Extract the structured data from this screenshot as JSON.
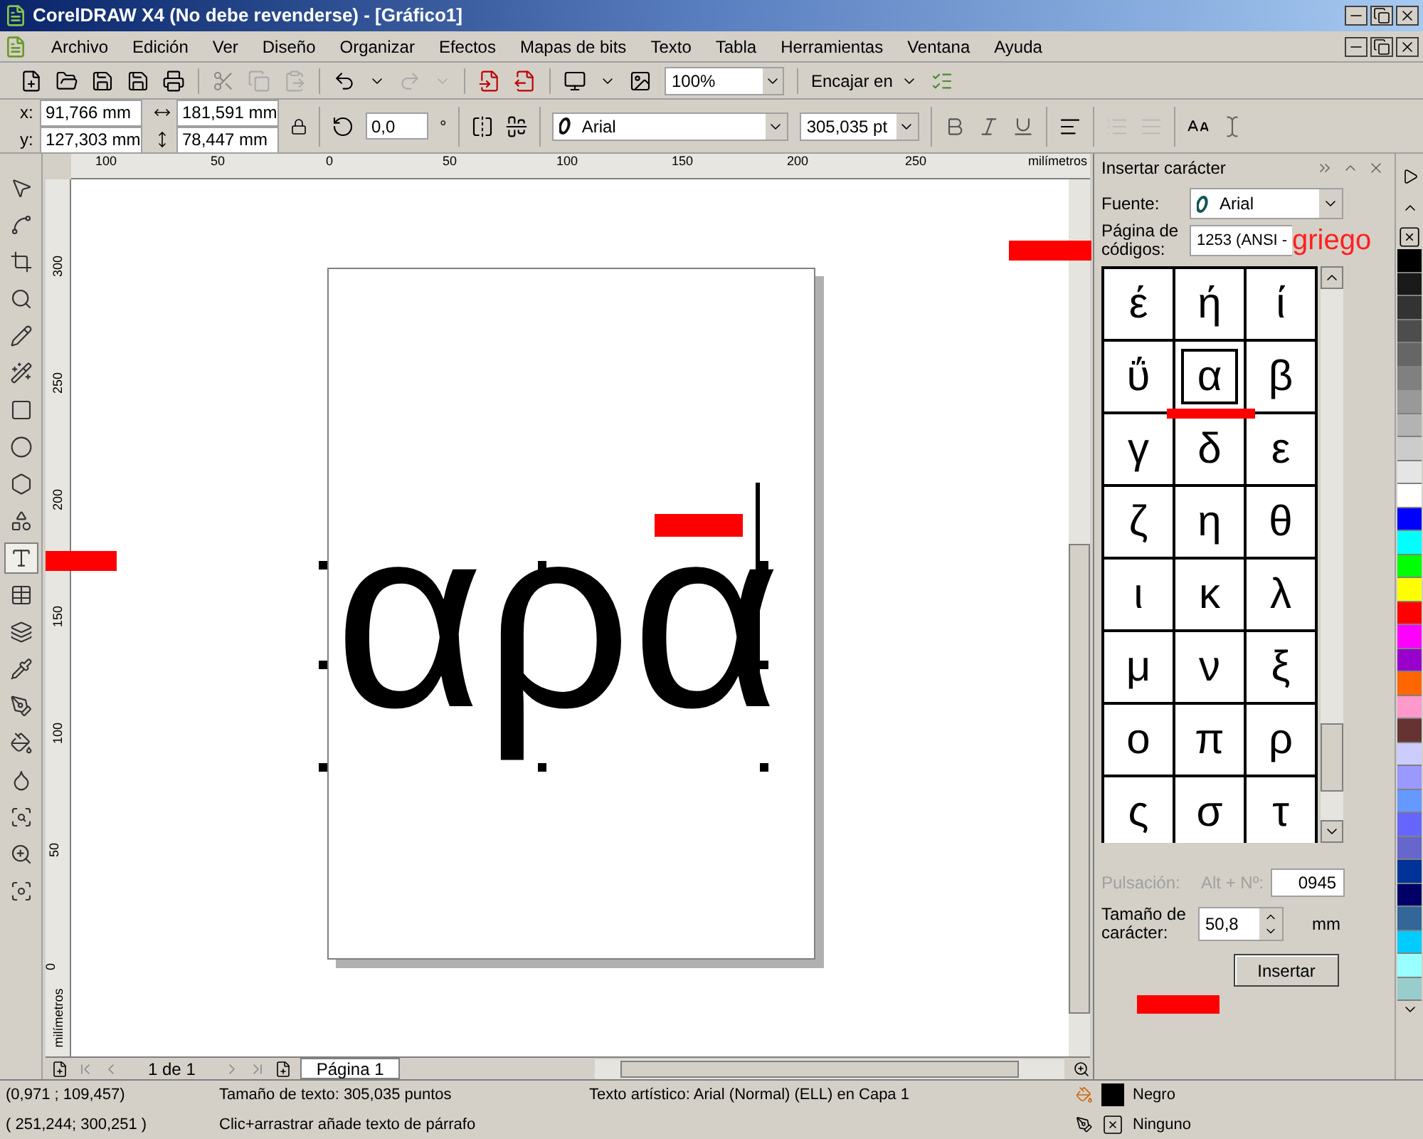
{
  "window": {
    "title": "CorelDRAW X4 (No debe revenderse) - [Gráfico1]"
  },
  "menu": [
    "Archivo",
    "Edición",
    "Ver",
    "Diseño",
    "Organizar",
    "Efectos",
    "Mapas de bits",
    "Texto",
    "Tabla",
    "Herramientas",
    "Ventana",
    "Ayuda"
  ],
  "toolbar": {
    "zoom": "100%",
    "snap": "Encajar en"
  },
  "property_bar": {
    "x_label": "x:",
    "x": "91,766 mm",
    "y_label": "y:",
    "y": "127,303 mm",
    "width": "181,591 mm",
    "height": "78,447 mm",
    "rotation": "0,0",
    "degree_sign": "°",
    "font": "Arial",
    "font_size": "305,035 pt"
  },
  "toolbox": [
    {
      "selected": false
    },
    {
      "selected": false
    },
    {
      "selected": false
    },
    {
      "selected": false
    },
    {
      "selected": false
    },
    {
      "selected": false
    },
    {
      "selected": false
    },
    {
      "selected": false
    },
    {
      "selected": false
    },
    {
      "selected": false
    },
    {
      "selected": true
    },
    {
      "selected": false
    },
    {
      "selected": false
    },
    {
      "selected": false
    },
    {
      "selected": false
    },
    {
      "selected": false
    },
    {
      "selected": false
    },
    {
      "selected": false
    },
    {
      "selected": false
    },
    {
      "selected": false
    }
  ],
  "rulers": {
    "horizontal": [
      "100",
      "50",
      "0",
      "50",
      "100",
      "150",
      "200",
      "250"
    ],
    "horizontal_unit": "milímetros",
    "vertical": [
      "300",
      "250",
      "200",
      "150",
      "100",
      "50",
      "0"
    ],
    "vertical_unit": "milímetros"
  },
  "canvas": {
    "text": "αρα"
  },
  "page_nav": {
    "count": "1 de 1",
    "tab": "Página 1"
  },
  "docker": {
    "title": "Insertar carácter",
    "font_label": "Fuente:",
    "font": "Arial",
    "code_page_label": "Página de códigos:",
    "code_page": "1253  (ANSI -",
    "characters": [
      {
        "char": "έ",
        "selected": false
      },
      {
        "char": "ή",
        "selected": false
      },
      {
        "char": "ί",
        "selected": false
      },
      {
        "char": "ΰ",
        "selected": false
      },
      {
        "char": "α",
        "selected": true
      },
      {
        "char": "β",
        "selected": false
      },
      {
        "char": "γ",
        "selected": false
      },
      {
        "char": "δ",
        "selected": false
      },
      {
        "char": "ε",
        "selected": false
      },
      {
        "char": "ζ",
        "selected": false
      },
      {
        "char": "η",
        "selected": false
      },
      {
        "char": "θ",
        "selected": false
      },
      {
        "char": "ι",
        "selected": false
      },
      {
        "char": "κ",
        "selected": false
      },
      {
        "char": "λ",
        "selected": false
      },
      {
        "char": "μ",
        "selected": false
      },
      {
        "char": "ν",
        "selected": false
      },
      {
        "char": "ξ",
        "selected": false
      },
      {
        "char": "ο",
        "selected": false
      },
      {
        "char": "π",
        "selected": false
      },
      {
        "char": "ρ",
        "selected": false
      },
      {
        "char": "ς",
        "selected": false
      },
      {
        "char": "σ",
        "selected": false
      },
      {
        "char": "τ",
        "selected": false
      }
    ],
    "keystroke_label": "Pulsación:",
    "alt_label": "Alt + Nº:",
    "keystroke_disabled": true,
    "alt_code": "0945",
    "size_label": "Tamaño de carácter:",
    "size": "50,8",
    "size_unit": "mm",
    "insert_button": "Insertar"
  },
  "palette": [
    {
      "color": "#000000"
    },
    {
      "color": "#1a1a1a"
    },
    {
      "color": "#333333"
    },
    {
      "color": "#4d4d4d"
    },
    {
      "color": "#666666"
    },
    {
      "color": "#808080"
    },
    {
      "color": "#999999"
    },
    {
      "color": "#b3b3b3"
    },
    {
      "color": "#cccccc"
    },
    {
      "color": "#e5e5e5"
    },
    {
      "color": "#ffffff"
    },
    {
      "color": "#0000ff"
    },
    {
      "color": "#00ffff"
    },
    {
      "color": "#00ff00"
    },
    {
      "color": "#ffff00"
    },
    {
      "color": "#ff0000"
    },
    {
      "color": "#ff00ff"
    },
    {
      "color": "#9900cc"
    },
    {
      "color": "#ff6600"
    },
    {
      "color": "#ff99cc"
    },
    {
      "color": "#663333"
    },
    {
      "color": "#ccccff"
    },
    {
      "color": "#9999ff"
    },
    {
      "color": "#6699ff"
    },
    {
      "color": "#6666ff"
    },
    {
      "color": "#6666cc"
    },
    {
      "color": "#003399"
    },
    {
      "color": "#000066"
    },
    {
      "color": "#336699"
    },
    {
      "color": "#00ccff"
    },
    {
      "color": "#99ffff"
    },
    {
      "color": "#99cccc"
    }
  ],
  "status_bar": {
    "cursor": "(0,971 ; 109,457)",
    "text_size": "Tamaño de texto: 305,035 puntos",
    "object_info": "Texto artístico: Arial (Normal) (ELL) en Capa 1",
    "cursor_2": "( 251,244; 300,251 )",
    "hint": "Clic+arrastrar añade texto de párrafo",
    "fill": "Negro",
    "outline": "Ninguno"
  },
  "annotation": "griego"
}
